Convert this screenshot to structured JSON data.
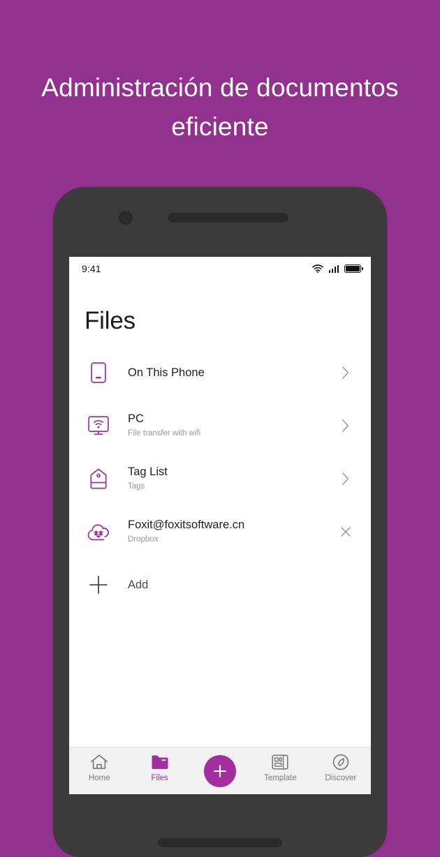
{
  "theme": {
    "background_purple": "#93318f",
    "accent_purple": "#a32ea0",
    "device_body": "#3b3b3b",
    "tabbar_background": "#f2f2f2",
    "muted_text": "#9a9a9a"
  },
  "headline": {
    "text": "Administración de documentos eficiente"
  },
  "phone": {
    "status_bar": {
      "time": "9:41",
      "icons": [
        "wifi-icon",
        "cellular-signal-icon",
        "battery-icon"
      ]
    },
    "screen": {
      "page_title": "Files",
      "list": [
        {
          "icon": "phone-icon",
          "title": "On This Phone",
          "subtitle": "",
          "trailing": "chevron-right-icon"
        },
        {
          "icon": "monitor-wifi-icon",
          "title": "PC",
          "subtitle": "File transfer with wifi",
          "trailing": "chevron-right-icon"
        },
        {
          "icon": "tag-icon",
          "title": "Tag List",
          "subtitle": "Tags",
          "trailing": "chevron-right-icon"
        },
        {
          "icon": "dropbox-cloud-icon",
          "title": "Foxit@foxitsoftware.cn",
          "subtitle": "Dropbox",
          "trailing": "close-icon"
        },
        {
          "icon": "plus-icon",
          "title": "Add",
          "subtitle": "",
          "trailing": ""
        }
      ],
      "tabbar": [
        {
          "icon": "home-icon",
          "label": "Home",
          "active": false
        },
        {
          "icon": "folder-icon",
          "label": "Files",
          "active": true
        },
        {
          "icon": "plus-icon",
          "label": "",
          "active": false
        },
        {
          "icon": "template-icon",
          "label": "Template",
          "active": false
        },
        {
          "icon": "compass-icon",
          "label": "Discover",
          "active": false
        }
      ]
    }
  }
}
